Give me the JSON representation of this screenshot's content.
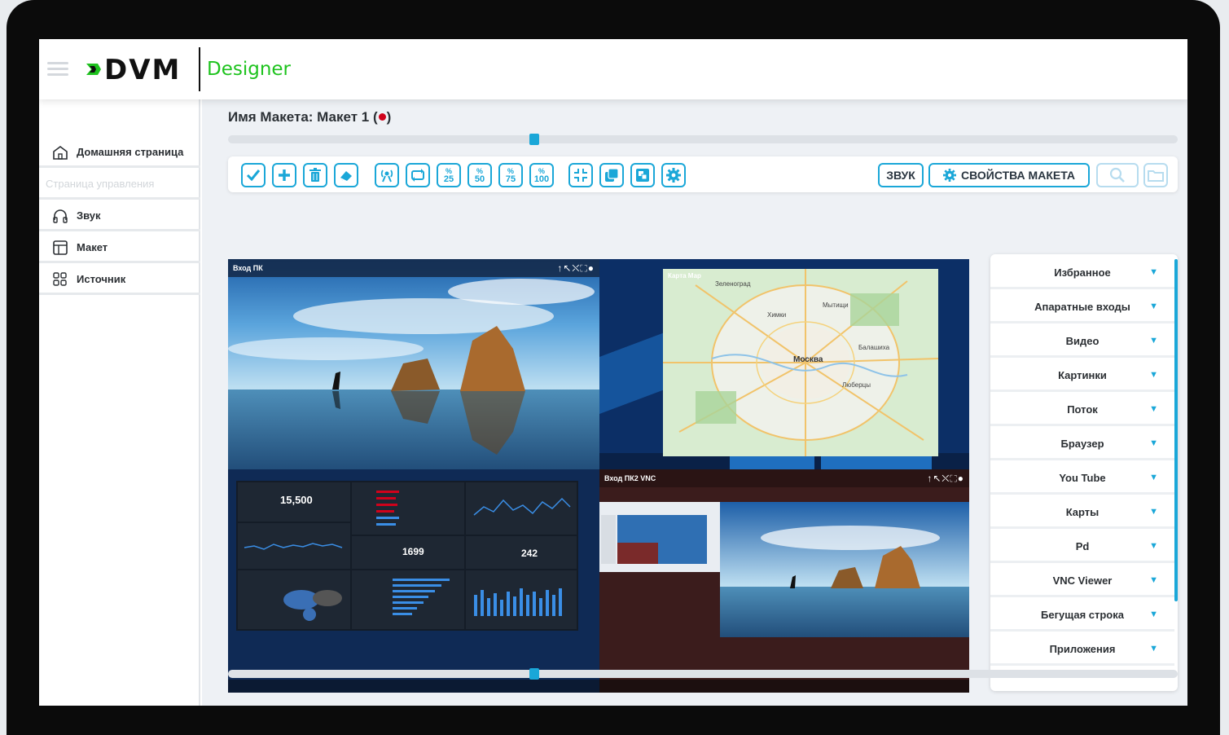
{
  "header": {
    "logo_text": "DVM",
    "logo_sub": "Designer"
  },
  "sidebar": {
    "items": [
      {
        "label": "Домашняя страница",
        "icon": "home-icon"
      },
      {
        "label": "Страница управления",
        "icon": ""
      },
      {
        "label": "Звук",
        "icon": "headphones-icon"
      },
      {
        "label": "Макет",
        "icon": "layout-icon"
      },
      {
        "label": "Источник",
        "icon": "grid-icon"
      }
    ]
  },
  "main": {
    "title_prefix": "Имя Макета: Макет 1 (",
    "title_suffix": ")",
    "toolbar": {
      "pct": [
        "25",
        "50",
        "75",
        "100"
      ],
      "pct_symbol": "%",
      "sound_label": "ЗВУК",
      "props_label": "СВОЙСТВА МАКЕТА"
    },
    "windows": {
      "pc_input": "Вход ПК",
      "map_title": "Карта Мар",
      "vnc_input": "Вход ПК2 VNC"
    },
    "map": {
      "labels": [
        "Зеленоград",
        "Мытищи",
        "Химки",
        "Москва",
        "Балашиха",
        "Люберцы"
      ]
    },
    "dashboard": {
      "impressions": "15,500",
      "followers": "1699",
      "clicks": "242"
    }
  },
  "rpanel": {
    "items": [
      "Избранное",
      "Апаратные входы",
      "Видео",
      "Картинки",
      "Поток",
      "Браузер",
      "You Tube",
      "Карты",
      "Pd",
      "VNC Viewer",
      "Бегущая строка",
      "Приложения"
    ]
  },
  "colors": {
    "accent": "#1aa7d8",
    "logo_green": "#1ec31e",
    "record": "#d0021b"
  }
}
